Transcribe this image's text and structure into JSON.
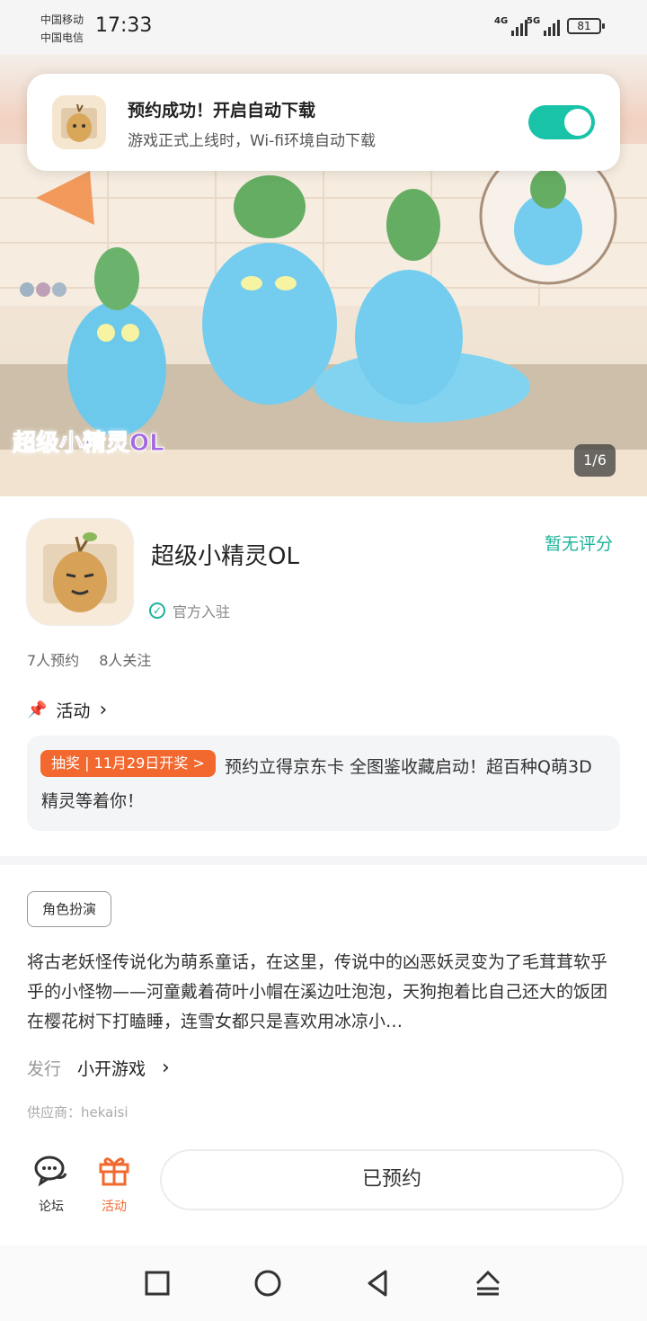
{
  "status_bar": {
    "carrier_1": "中国移动",
    "carrier_2": "中国电信",
    "time": "17:33",
    "signal_1": "4G",
    "signal_2": "5G",
    "battery": "81"
  },
  "banner": {
    "pager": "1/6",
    "logo_text": "超级小精灵OL"
  },
  "toast": {
    "title": "预约成功！开启自动下载",
    "subtitle": "游戏正式上线时，Wi-fi环境自动下载",
    "toggle_on": true
  },
  "app": {
    "name": "超级小精灵OL",
    "rating": "暂无评分",
    "official": "官方入驻",
    "reservations": "7人预约",
    "followers": "8人关注"
  },
  "activity": {
    "heading": "活动",
    "badge": "抽奖 | 11月29日开奖 >",
    "text": "预约立得京东卡 全图鉴收藏启动！超百种Q萌3D精灵等着你！"
  },
  "details": {
    "tag": "角色扮演",
    "description": "将古老妖怪传说化为萌系童话，在这里，传说中的凶恶妖灵变为了毛茸茸软乎乎的小怪物——河童戴着荷叶小帽在溪边吐泡泡，天狗抱着比自己还大的饭团在樱花树下打瞌睡，连雪女都只是喜欢用冰凉小…",
    "publisher_label": "发行",
    "publisher_name": "小开游戏",
    "supplier": "供应商：hekaisi"
  },
  "bottom_bar": {
    "forum": "论坛",
    "activity": "活动",
    "reserved_button": "已预约"
  },
  "colors": {
    "accent_teal": "#19c3a7",
    "accent_orange": "#f2682e"
  }
}
